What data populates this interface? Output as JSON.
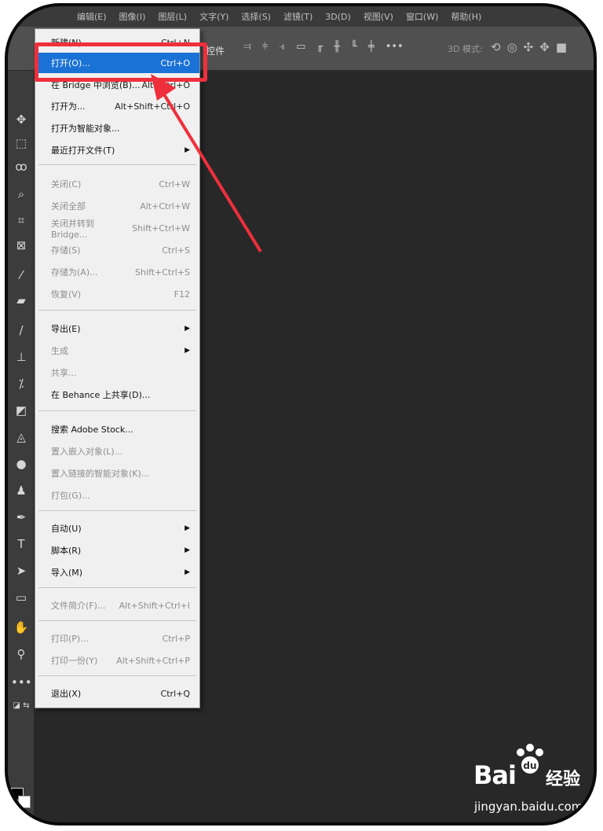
{
  "menubar": {
    "items": [
      "编辑(E)",
      "图像(I)",
      "图层(L)",
      "文字(Y)",
      "选择(S)",
      "滤镜(T)",
      "3D(D)",
      "视图(V)",
      "窗口(W)",
      "帮助(H)"
    ]
  },
  "optionsbar": {
    "label": "控件",
    "align_icons": [
      "align-left-icon",
      "align-center-icon",
      "align-right-icon",
      "distribute-icon",
      "align-top-icon",
      "align-middle-icon",
      "align-bottom-icon",
      "distribute-v-icon",
      "more-icon"
    ],
    "mode_3d_label": "3D 模式:",
    "mode_3d_icons": [
      "orbit-icon",
      "roll-icon",
      "drag-icon",
      "slide-icon",
      "camera-icon"
    ]
  },
  "file_menu": {
    "new": {
      "label": "新建(N)...",
      "shortcut": "Ctrl+N"
    },
    "open": {
      "label": "打开(O)...",
      "shortcut": "Ctrl+O"
    },
    "browse_bridge": {
      "label": "在 Bridge 中浏览(B)...",
      "shortcut": "Alt+Ctrl+O"
    },
    "open_as": {
      "label": "打开为...",
      "shortcut": "Alt+Shift+Ctrl+O"
    },
    "open_smart": {
      "label": "打开为智能对象..."
    },
    "recent": {
      "label": "最近打开文件(T)"
    },
    "close": {
      "label": "关闭(C)",
      "shortcut": "Ctrl+W"
    },
    "close_all": {
      "label": "关闭全部",
      "shortcut": "Alt+Ctrl+W"
    },
    "close_bridge": {
      "label": "关闭并转到 Bridge...",
      "shortcut": "Shift+Ctrl+W"
    },
    "save": {
      "label": "存储(S)",
      "shortcut": "Ctrl+S"
    },
    "save_as": {
      "label": "存储为(A)...",
      "shortcut": "Shift+Ctrl+S"
    },
    "revert": {
      "label": "恢复(V)",
      "shortcut": "F12"
    },
    "export": {
      "label": "导出(E)"
    },
    "generate": {
      "label": "生成"
    },
    "share": {
      "label": "共享..."
    },
    "share_behance": {
      "label": "在 Behance 上共享(D)..."
    },
    "search_stock": {
      "label": "搜索 Adobe Stock..."
    },
    "place_embedded": {
      "label": "置入嵌入对象(L)..."
    },
    "place_linked": {
      "label": "置入链接的智能对象(K)..."
    },
    "package": {
      "label": "打包(G)..."
    },
    "automate": {
      "label": "自动(U)"
    },
    "scripts": {
      "label": "脚本(R)"
    },
    "import": {
      "label": "导入(M)"
    },
    "file_info": {
      "label": "文件简介(F)...",
      "shortcut": "Alt+Shift+Ctrl+I"
    },
    "print": {
      "label": "打印(P)...",
      "shortcut": "Ctrl+P"
    },
    "print_one": {
      "label": "打印一份(Y)",
      "shortcut": "Alt+Shift+Ctrl+P"
    },
    "exit": {
      "label": "退出(X)",
      "shortcut": "Ctrl+Q"
    }
  },
  "colors": {
    "highlight_red": "#ef2f3c",
    "active_blue": "#1b72d6",
    "canvas": "#282828"
  },
  "watermark": {
    "brand": "Bai",
    "brand_cn": "经验",
    "url": "jingyan.baidu.com"
  }
}
